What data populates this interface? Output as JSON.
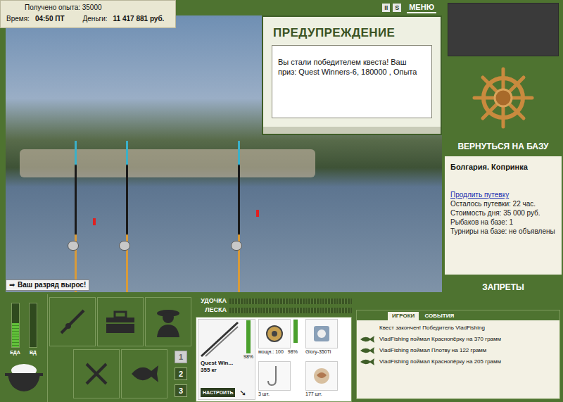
{
  "header": {
    "experience": "Получено опыта: 35000",
    "time_label": "Время:",
    "time": "04:50 ПТ",
    "money_label": "Деньги:",
    "money": "11 417 881 руб."
  },
  "toolbar": [
    {
      "label": "II"
    },
    {
      "label": "S"
    },
    {
      "label": "МЕНЮ"
    }
  ],
  "warning": {
    "title": "ПРЕДУПРЕЖДЕНИЕ",
    "message": "Вы стали победителем квеста! Ваш приз: Quest Winners-6, 180000 , Опыта"
  },
  "notice": "Ваш разряд вырос!",
  "sidebar": {
    "return_button": "ВЕРНУТЬСЯ НА БАЗУ",
    "location": "Болгария. Копринка",
    "extend_link": "Продлить путевку",
    "info": [
      "Осталось путевки: 22 час.",
      "Стоимость дня: 35 000 руб.",
      "Рыбаков на базе: 1",
      "Турниры на базе: не объявлены"
    ],
    "bans_button": "ЗАПРЕТЫ"
  },
  "needs": [
    {
      "label": "ЕДА",
      "level": 0.55
    },
    {
      "label": "ВД",
      "level": 0
    }
  ],
  "page_buttons": [
    {
      "label": "1",
      "selected": true
    },
    {
      "label": "2",
      "selected": false
    },
    {
      "label": "3",
      "selected": false
    }
  ],
  "tension": [
    {
      "label": "УДОЧКА",
      "level": 0
    },
    {
      "label": "ЛЕСКА",
      "level": 0
    }
  ],
  "tackle": {
    "rod": {
      "name": "Quest Win...",
      "capacity": "355 кг",
      "level": 0.98,
      "reading": "98%",
      "button": "НАСТРОИТЬ"
    },
    "reel": {
      "power": "мощн.: 100",
      "level": 0.98,
      "reading": "98%"
    },
    "line": {
      "name": "Glory-350Ti"
    },
    "hook": {
      "count": "3 шт."
    },
    "bait": {
      "count": "177 шт."
    }
  },
  "chat": {
    "tabs": [
      {
        "label": "ИГРОКИ",
        "selected": true
      },
      {
        "label": "СОБЫТИЯ",
        "selected": false
      }
    ],
    "messages": [
      {
        "kind": "system",
        "text": "Квест закончен! Победитель VladFishing"
      },
      {
        "kind": "catch",
        "text": "VladFishing поймал Краснопёрку на 370 грамм"
      },
      {
        "kind": "catch",
        "text": "VladFishing поймал Плотву на 122 грамм"
      },
      {
        "kind": "catch",
        "text": "VladFishing поймал Краснопёрку на 205 грамм"
      }
    ]
  }
}
